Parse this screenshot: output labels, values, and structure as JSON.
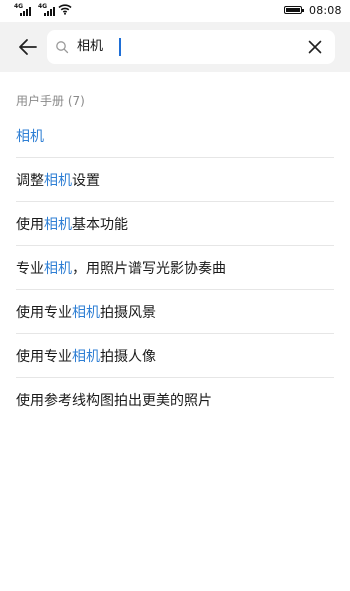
{
  "status_bar": {
    "network_label_1": "4G",
    "network_label_2": "4G",
    "time": "08:08"
  },
  "search": {
    "query": "相机",
    "back_icon": "arrow-left-icon",
    "search_icon": "magnifier-icon",
    "clear_icon": "close-icon"
  },
  "section": {
    "title": "用户手册 (7)"
  },
  "results": [
    {
      "before": "",
      "match": "相机",
      "after": ""
    },
    {
      "before": "调整",
      "match": "相机",
      "after": "设置"
    },
    {
      "before": "使用",
      "match": "相机",
      "after": "基本功能"
    },
    {
      "before": "专业",
      "match": "相机",
      "after": "，用照片谱写光影协奏曲"
    },
    {
      "before": "使用专业",
      "match": "相机",
      "after": "拍摄风景"
    },
    {
      "before": "使用专业",
      "match": "相机",
      "after": "拍摄人像"
    },
    {
      "before": "使用参考线构图拍出更美的照片",
      "match": "",
      "after": ""
    }
  ],
  "colors": {
    "highlight": "#2f7fd4",
    "header_bg": "#f2f2f2",
    "cursor": "#1f6fd6"
  }
}
